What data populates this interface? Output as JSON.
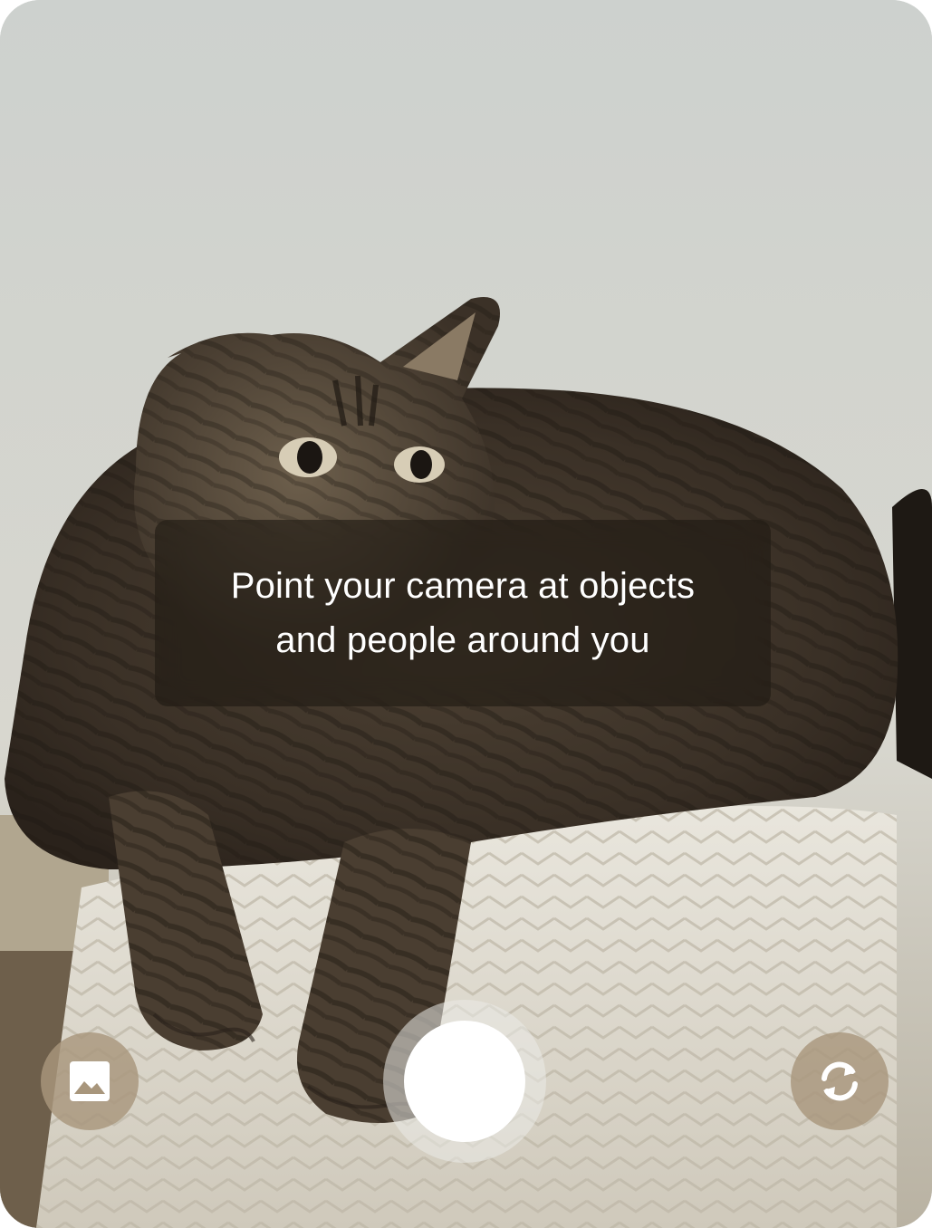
{
  "camera": {
    "hint": {
      "line1": "Point your camera at objects",
      "line2": "and people around you"
    },
    "controls": {
      "gallery_icon": "image-gallery-icon",
      "shutter_icon": "shutter-button",
      "flip_icon": "camera-flip-icon"
    },
    "colors": {
      "overlay": "#1e1812",
      "button_fill": "#a8967c",
      "shutter": "#ffffff"
    }
  }
}
